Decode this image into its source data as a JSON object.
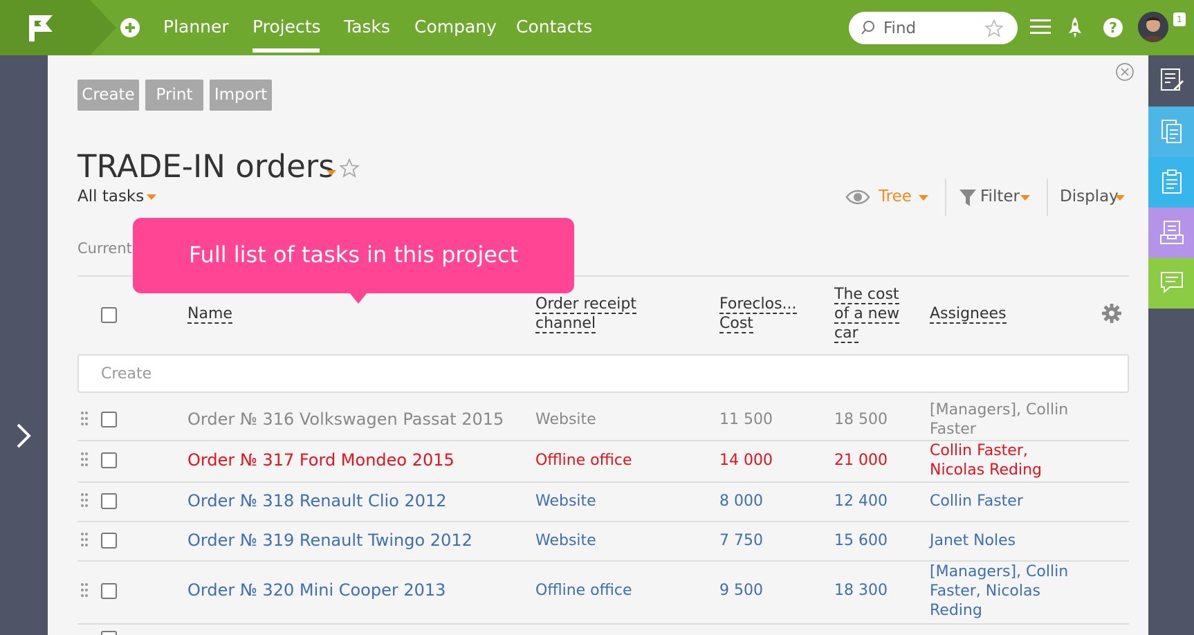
{
  "nav": {
    "items": [
      "Planner",
      "Projects",
      "Tasks",
      "Company",
      "Contacts"
    ],
    "active": "Projects",
    "find_placeholder": "Find",
    "badge": "1"
  },
  "toolbar": {
    "create": "Create",
    "print": "Print",
    "import": "Import"
  },
  "page": {
    "title": "TRADE-IN orders",
    "filter_view": "All tasks",
    "current_label": "Current"
  },
  "view_controls": {
    "tree": "Tree",
    "filter": "Filter",
    "display": "Display"
  },
  "tooltip": "Full list of tasks in this project",
  "table": {
    "headers": {
      "name": "Name",
      "channel_1": "Order receipt",
      "channel_2": "channel",
      "foreclosure_1": "Foreclos...",
      "foreclosure_2": "Cost",
      "newcar_1": "The cost",
      "newcar_2": "of a new",
      "newcar_3": "car",
      "assignees": "Assignees"
    },
    "create_placeholder": "Create",
    "rows": [
      {
        "name": "Order № 316 Volkswagen Passat 2015",
        "channel": "Website",
        "foreclosure": "11 500",
        "newcar": "18 500",
        "assignees_1": "[Managers], Collin",
        "assignees_2": "Faster",
        "assignees_3": "",
        "status": "done"
      },
      {
        "name": "Order № 317 Ford Mondeo 2015",
        "channel": "Offline office",
        "foreclosure": "14 000",
        "newcar": "21 000",
        "assignees_1": "Collin Faster,",
        "assignees_2": "Nicolas Reding",
        "assignees_3": "",
        "status": "overdue"
      },
      {
        "name": "Order № 318 Renault Clio 2012",
        "channel": "Website",
        "foreclosure": "8 000",
        "newcar": "12 400",
        "assignees_1": "Collin Faster",
        "assignees_2": "",
        "assignees_3": "",
        "status": "active"
      },
      {
        "name": "Order № 319 Renault Twingo 2012",
        "channel": "Website",
        "foreclosure": "7 750",
        "newcar": "15 600",
        "assignees_1": "Janet Noles",
        "assignees_2": "",
        "assignees_3": "",
        "status": "active"
      },
      {
        "name": "Order № 320 Mini Cooper 2013",
        "channel": "Offline office",
        "foreclosure": "9 500",
        "newcar": "18 300",
        "assignees_1": "[Managers], Collin",
        "assignees_2": "Faster, Nicolas",
        "assignees_3": "Reding",
        "status": "active"
      }
    ]
  },
  "colors": {
    "brand_green": "#6fa82f",
    "accent_orange": "#f28c1b",
    "tooltip_pink": "#ff4593",
    "done_gray": "#888888",
    "overdue_red": "#e0141e",
    "active_blue": "#3e6fb0"
  },
  "icons": {
    "logo": "flag-logo-icon",
    "add": "plus-circle-icon",
    "search": "search-icon",
    "star": "star-icon",
    "menu": "hamburger-icon",
    "rocket": "rocket-icon",
    "help": "question-icon",
    "close": "close-circle-icon",
    "eye": "eye-icon",
    "filter": "funnel-icon",
    "gear": "gear-icon",
    "expand": "chevron-right-icon"
  }
}
